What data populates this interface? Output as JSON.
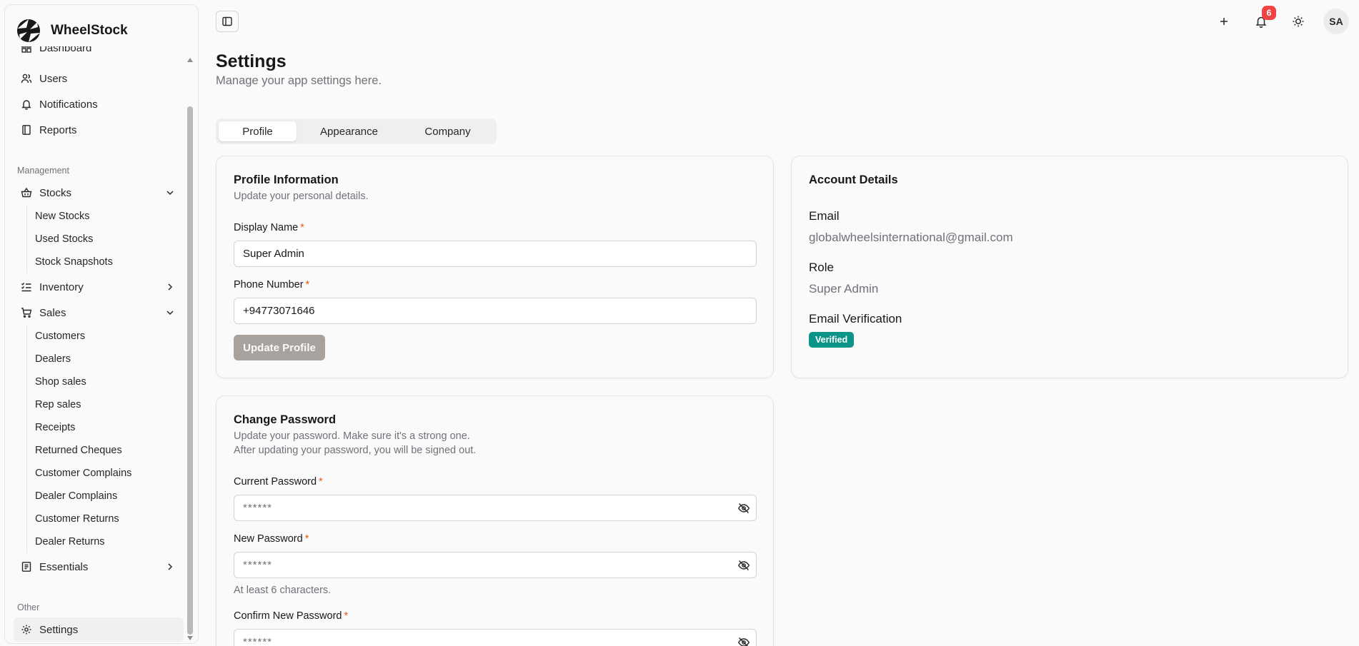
{
  "app": {
    "name": "WheelStock"
  },
  "sidebar": {
    "top_items": [
      {
        "label": "Dashboard",
        "icon": "dashboard-icon"
      },
      {
        "label": "Users",
        "icon": "users-icon"
      },
      {
        "label": "Notifications",
        "icon": "bell-icon"
      },
      {
        "label": "Reports",
        "icon": "book-icon"
      }
    ],
    "groups": {
      "management": "Management",
      "other": "Other"
    },
    "stocks": {
      "label": "Stocks",
      "sub": [
        "New Stocks",
        "Used Stocks",
        "Stock Snapshots"
      ]
    },
    "inventory": {
      "label": "Inventory"
    },
    "sales": {
      "label": "Sales",
      "sub": [
        "Customers",
        "Dealers",
        "Shop sales",
        "Rep sales",
        "Receipts",
        "Returned Cheques",
        "Customer Complains",
        "Dealer Complains",
        "Customer Returns",
        "Dealer Returns"
      ]
    },
    "essentials": {
      "label": "Essentials"
    },
    "settings": {
      "label": "Settings"
    }
  },
  "header": {
    "notification_count": "6",
    "avatar_initials": "SA"
  },
  "page": {
    "title": "Settings",
    "subtitle": "Manage your app settings here."
  },
  "tabs": [
    {
      "label": "Profile",
      "active": true
    },
    {
      "label": "Appearance",
      "active": false
    },
    {
      "label": "Company",
      "active": false
    }
  ],
  "profile_card": {
    "title": "Profile Information",
    "description": "Update your personal details.",
    "display_name_label": "Display Name",
    "display_name_value": "Super Admin",
    "phone_label": "Phone Number",
    "phone_value": "+94773071646",
    "update_button": "Update Profile",
    "required_mark": "*"
  },
  "account_card": {
    "title": "Account Details",
    "email_label": "Email",
    "email_value": "globalwheelsinternational@gmail.com",
    "role_label": "Role",
    "role_value": "Super Admin",
    "verification_label": "Email Verification",
    "verification_status": "Verified"
  },
  "password_card": {
    "title": "Change Password",
    "description_line1": "Update your password. Make sure it's a strong one.",
    "description_line2": "After updating your password, you will be signed out.",
    "current_label": "Current Password",
    "current_placeholder": "******",
    "new_label": "New Password",
    "new_placeholder": "******",
    "new_helper": "At least 6 characters.",
    "confirm_label": "Confirm New Password",
    "confirm_placeholder": "******"
  },
  "colors": {
    "accent_badge": "#0d9488",
    "notification_badge": "#ef4444",
    "required": "#e8590c",
    "disabled_button": "#a8a29e"
  }
}
